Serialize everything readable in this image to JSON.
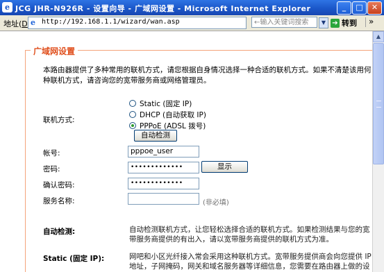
{
  "window": {
    "title": "JCG JHR-N926R - 设置向导 - 广域网设置 - Microsoft Internet Explorer",
    "app_icon": "ie-icon",
    "buttons": {
      "minimize": "_",
      "maximize": "□",
      "close": "✕"
    }
  },
  "address_bar": {
    "label": "地址",
    "label_key": "D",
    "url": "http://192.168.1.1/wizard/wan.asp",
    "search_placeholder": "←输入关键词搜索",
    "go_label": "转到"
  },
  "section": {
    "legend": "广域网设置",
    "intro": "本路由器提供了多种常用的联机方式，请您根据自身情况选择一种合适的联机方式。如果不清楚该用何种联机方式，请咨询您的宽带服务商或网络管理员。"
  },
  "form": {
    "connection_label": "联机方式:",
    "options": [
      {
        "label": "Static (固定 IP)",
        "checked": false
      },
      {
        "label": "DHCP (自动获取 IP)",
        "checked": false
      },
      {
        "label": "PPPoE (ADSL 拨号)",
        "checked": true
      }
    ],
    "auto_detect_button": "自动检测",
    "account_label": "帐号:",
    "account_value": "pppoe_user",
    "password_label": "密码:",
    "password_value": "•••••••••••••",
    "show_button": "显示",
    "confirm_label": "确认密码:",
    "confirm_value": "•••••••••••••",
    "service_label": "服务名称:",
    "service_value": "",
    "service_hint": "(非必填)"
  },
  "help": [
    {
      "term": "自动检测:",
      "text": "自动检测联机方式，让您轻松选择合适的联机方式。如果检测结果与您的宽带服务商提供的有出入，请以宽带服务商提供的联机方式为准。"
    },
    {
      "term": "Static (固定 IP):",
      "text": "网吧和小区光纤接入常会采用这种联机方式。宽带服务提供商会向您提供 IP 地址，子网掩码，网关和域名服务器等详细信息，您需要在路由器上做的设置这些参数才能正常上网。"
    }
  ]
}
